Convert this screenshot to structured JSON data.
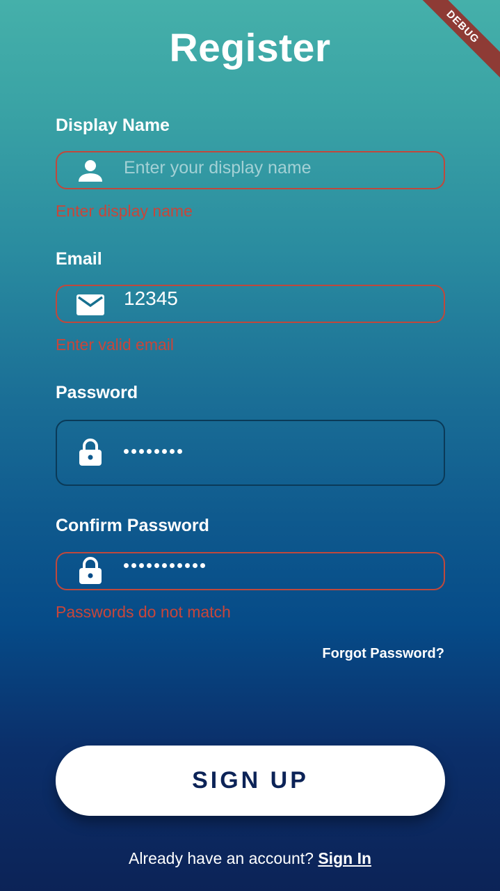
{
  "header": {
    "title": "Register"
  },
  "debug_banner": "DEBUG",
  "fields": {
    "display_name": {
      "label": "Display Name",
      "placeholder": "Enter your display name",
      "value": "",
      "error": "Enter display name",
      "icon": "person-icon"
    },
    "email": {
      "label": "Email",
      "value": "12345",
      "error": "Enter valid email",
      "icon": "mail-icon"
    },
    "password": {
      "label": "Password",
      "masked_length": 8,
      "icon": "lock-icon"
    },
    "confirm_password": {
      "label": "Confirm Password",
      "masked_length": 11,
      "error": "Passwords do not match",
      "icon": "lock-icon"
    }
  },
  "forgot_password": "Forgot Password?",
  "signup_button": "SIGN UP",
  "footer": {
    "prompt": "Already have an account?",
    "signin_link": "Sign In"
  },
  "colors": {
    "error": "#c8463a",
    "button_text": "#0c2357",
    "gradient_top": "#45b0aa",
    "gradient_bottom": "#0c2357"
  }
}
